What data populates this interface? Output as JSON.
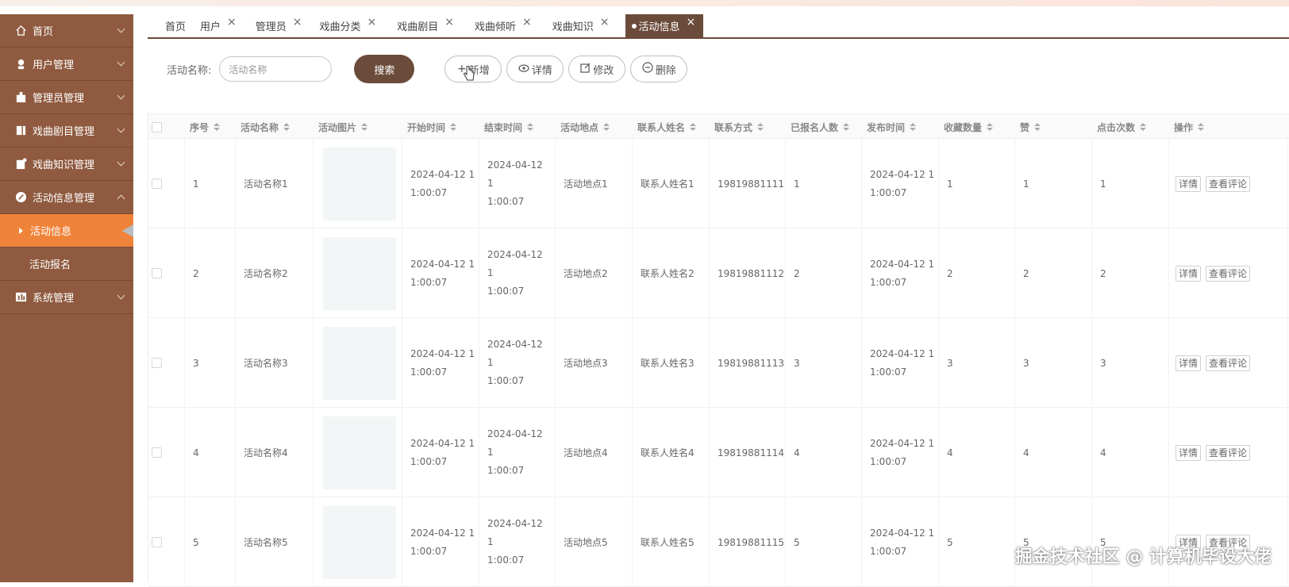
{
  "sidebar": {
    "items": [
      {
        "label": "首页",
        "icon": "home-icon"
      },
      {
        "label": "用户管理",
        "icon": "user-icon"
      },
      {
        "label": "管理员管理",
        "icon": "admin-icon"
      },
      {
        "label": "戏曲剧目管理",
        "icon": "book-icon"
      },
      {
        "label": "戏曲知识管理",
        "icon": "doc-icon"
      },
      {
        "label": "活动信息管理",
        "icon": "activity-icon"
      }
    ],
    "sub_items": [
      {
        "label": "活动信息"
      },
      {
        "label": "活动报名"
      }
    ],
    "last_item": {
      "label": "系统管理",
      "icon": "chart-icon"
    }
  },
  "tabs": [
    {
      "label": "首页"
    },
    {
      "label": "用户"
    },
    {
      "label": "管理员"
    },
    {
      "label": "戏曲分类"
    },
    {
      "label": "戏曲剧目"
    },
    {
      "label": "戏曲倾听"
    },
    {
      "label": "戏曲知识"
    },
    {
      "label": "活动信息"
    }
  ],
  "toolbar": {
    "search_label": "活动名称:",
    "search_placeholder": "活动名称",
    "search_button": "搜索",
    "add_button": "新增",
    "detail_button": "详情",
    "edit_button": "修改",
    "delete_button": "删除"
  },
  "table": {
    "headers": [
      "序号",
      "活动名称",
      "活动图片",
      "开始时间",
      "结束时间",
      "活动地点",
      "联系人姓名",
      "联系方式",
      "已报名人数",
      "发布时间",
      "收藏数量",
      "赞",
      "点击次数",
      "操作"
    ],
    "op_detail": "详情",
    "op_comments": "查看评论",
    "rows": [
      {
        "no": "1",
        "name": "活动名称1",
        "start_a": "2024-04-12 1",
        "start_b": "1:00:07",
        "end_a": "2024-04-12 1",
        "end_b": "1:00:07",
        "place": "活动地点1",
        "contact": "联系人姓名1",
        "phone": "19819881111",
        "signed": "1",
        "pub_a": "2024-04-12 1",
        "pub_b": "1:00:07",
        "fav": "1",
        "likes": "1",
        "clicks": "1"
      },
      {
        "no": "2",
        "name": "活动名称2",
        "start_a": "2024-04-12 1",
        "start_b": "1:00:07",
        "end_a": "2024-04-12 1",
        "end_b": "1:00:07",
        "place": "活动地点2",
        "contact": "联系人姓名2",
        "phone": "19819881112",
        "signed": "2",
        "pub_a": "2024-04-12 1",
        "pub_b": "1:00:07",
        "fav": "2",
        "likes": "2",
        "clicks": "2"
      },
      {
        "no": "3",
        "name": "活动名称3",
        "start_a": "2024-04-12 1",
        "start_b": "1:00:07",
        "end_a": "2024-04-12 1",
        "end_b": "1:00:07",
        "place": "活动地点3",
        "contact": "联系人姓名3",
        "phone": "19819881113",
        "signed": "3",
        "pub_a": "2024-04-12 1",
        "pub_b": "1:00:07",
        "fav": "3",
        "likes": "3",
        "clicks": "3"
      },
      {
        "no": "4",
        "name": "活动名称4",
        "start_a": "2024-04-12 1",
        "start_b": "1:00:07",
        "end_a": "2024-04-12 1",
        "end_b": "1:00:07",
        "place": "活动地点4",
        "contact": "联系人姓名4",
        "phone": "19819881114",
        "signed": "4",
        "pub_a": "2024-04-12 1",
        "pub_b": "1:00:07",
        "fav": "4",
        "likes": "4",
        "clicks": "4"
      },
      {
        "no": "5",
        "name": "活动名称5",
        "start_a": "2024-04-12 1",
        "start_b": "1:00:07",
        "end_a": "2024-04-12 1",
        "end_b": "1:00:07",
        "place": "活动地点5",
        "contact": "联系人姓名5",
        "phone": "19819881115",
        "signed": "5",
        "pub_a": "2024-04-12 1",
        "pub_b": "1:00:07",
        "fav": "5",
        "likes": "5",
        "clicks": "5"
      }
    ]
  },
  "watermark": "掘金技术社区 @ 计算机毕设大佬",
  "colors": {
    "sidebar_bg": "#8f5a3f",
    "active_sub_bg": "#f0833a",
    "primary": "#6b4b3a"
  }
}
